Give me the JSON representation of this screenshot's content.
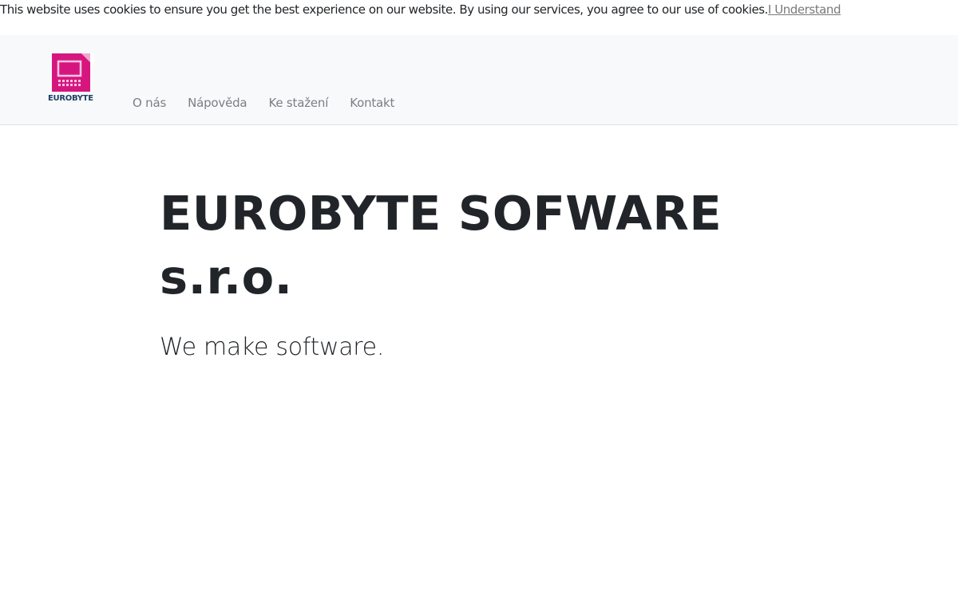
{
  "cookie_banner": {
    "message": "This website uses cookies to ensure you get the best experience on our website. By using our services, you agree to our use of cookies.",
    "accept_label": "I Understand"
  },
  "header": {
    "logo_text": "EUROBYTE",
    "logo_icon": "eurobyte-logo-icon",
    "nav": [
      {
        "label": "O nás"
      },
      {
        "label": "Nápověda"
      },
      {
        "label": "Ke stažení"
      },
      {
        "label": "Kontakt"
      }
    ]
  },
  "hero": {
    "title": "EUROBYTE SOFWARE s.r.o.",
    "subtitle": "We make software."
  },
  "colors": {
    "logo_magenta": "#d6167f",
    "logo_text": "#1f3f63",
    "nav_text": "#7b7f83",
    "navbar_bg": "#f8f9fa",
    "heading_text": "#212529"
  }
}
